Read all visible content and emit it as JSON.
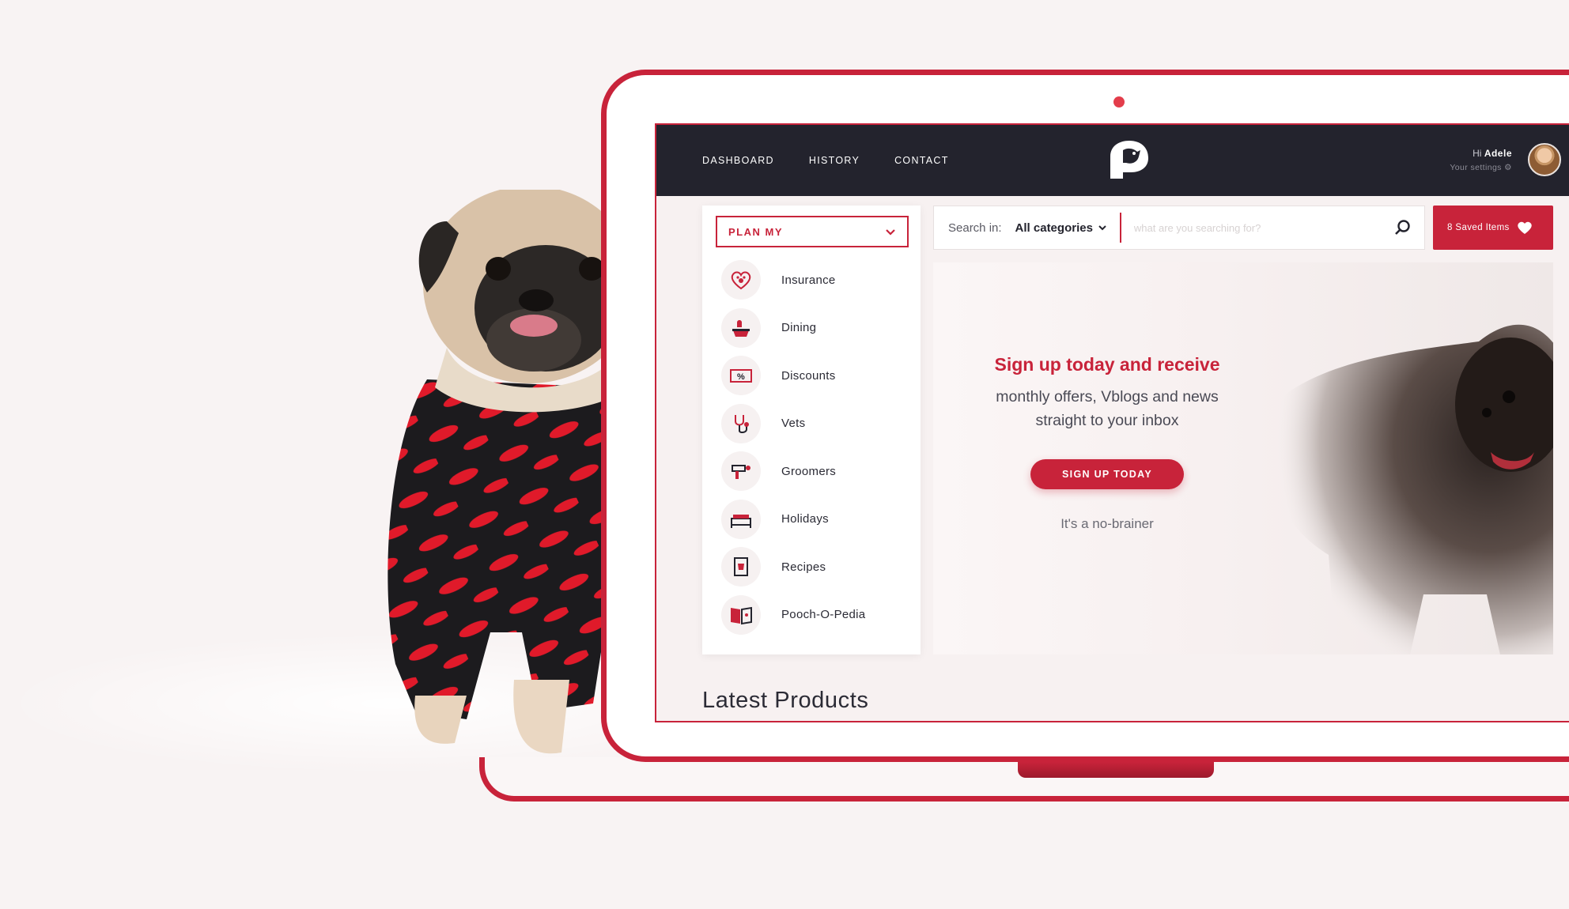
{
  "nav": {
    "items": [
      "DASHBOARD",
      "HISTORY",
      "CONTACT"
    ]
  },
  "user": {
    "greeting": "Hi",
    "name": "Adele",
    "settings_label": "Your settings"
  },
  "plan": {
    "label": "PLAN MY",
    "items": [
      {
        "label": "Insurance",
        "icon": "heart-paw-icon"
      },
      {
        "label": "Dining",
        "icon": "food-bowl-icon"
      },
      {
        "label": "Discounts",
        "icon": "discount-ticket-icon"
      },
      {
        "label": "Vets",
        "icon": "stethoscope-icon"
      },
      {
        "label": "Groomers",
        "icon": "hair-dryer-icon"
      },
      {
        "label": "Holidays",
        "icon": "bed-icon"
      },
      {
        "label": "Recipes",
        "icon": "recipe-book-icon"
      },
      {
        "label": "Pooch-O-Pedia",
        "icon": "open-book-icon"
      }
    ]
  },
  "search": {
    "prefix": "Search in:",
    "category": "All categories",
    "placeholder": "what are you searching for?"
  },
  "saved": {
    "label": "8 Saved Items"
  },
  "hero": {
    "title": "Sign up today and receive",
    "subtitle_line1": "monthly offers, Vblogs and news",
    "subtitle_line2": "straight to your inbox",
    "button": "SIGN UP TODAY",
    "note": "It's a no-brainer"
  },
  "section": {
    "latest_title": "Latest Products"
  },
  "colors": {
    "accent": "#c8233a",
    "header_bg": "#23232d",
    "page_bg": "#f8f3f3"
  }
}
